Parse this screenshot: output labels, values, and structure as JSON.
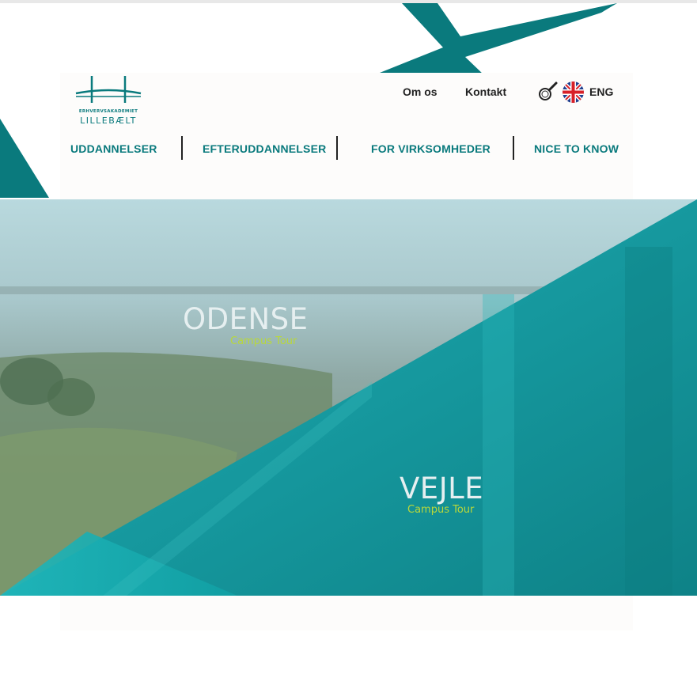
{
  "brand": {
    "logo_small": "ERHVERVSAKADEMIET",
    "logo_big": "LILLEBÆLT",
    "accent": "#0a7a7d",
    "campus_sub_color": "#b9d83a"
  },
  "utility_nav": {
    "about_label": "Om os",
    "contact_label": "Kontakt",
    "search_icon": "magnifier-icon",
    "flag_icon": "uk-flag-icon",
    "language_label": "ENG"
  },
  "main_nav": {
    "items": [
      {
        "label": "UDDANNELSER"
      },
      {
        "label": "EFTERUDDANNELSER"
      },
      {
        "label": "FOR VIRKSOMHEDER"
      },
      {
        "label": "NICE TO KNOW"
      }
    ]
  },
  "hero": {
    "odense": {
      "title": "ODENSE",
      "subtitle": "Campus Tour"
    },
    "vejle": {
      "title": "VEJLE",
      "subtitle": "Campus Tour"
    }
  }
}
